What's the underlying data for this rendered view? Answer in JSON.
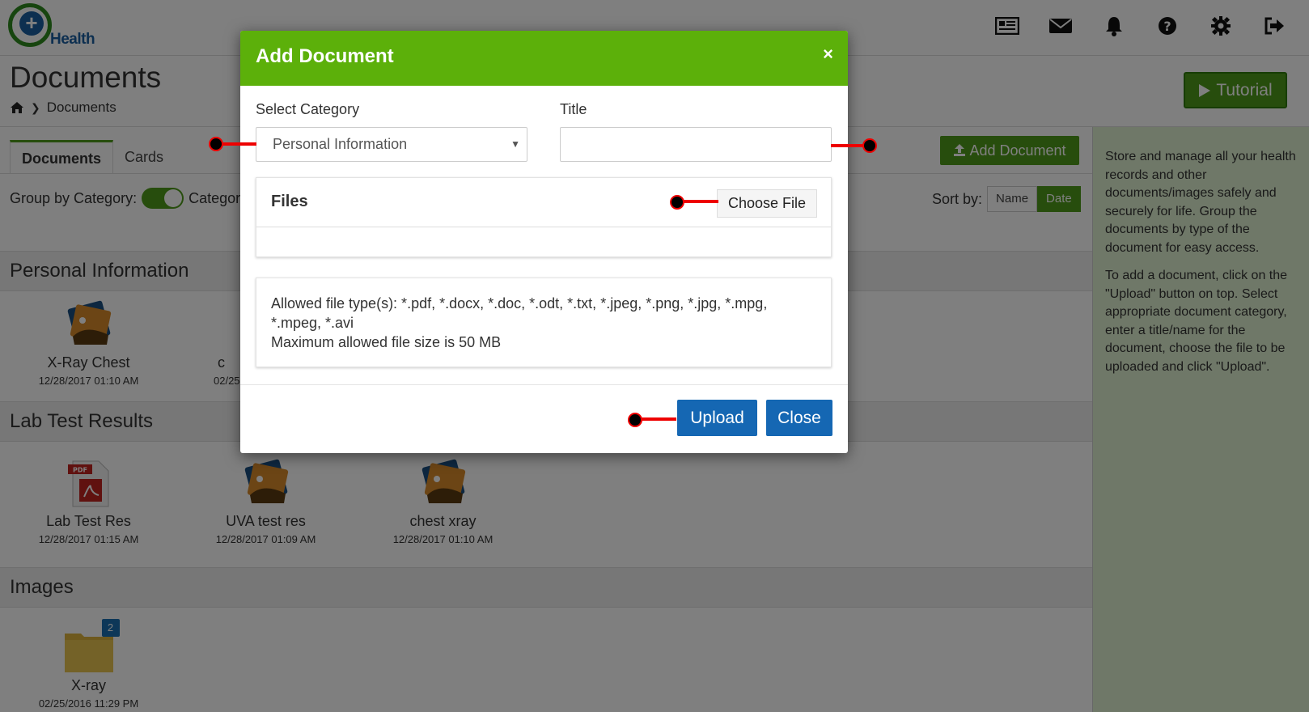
{
  "app": {
    "logo_text": "Health"
  },
  "page": {
    "title": "Documents",
    "breadcrumb": "Documents",
    "tutorial_label": "Tutorial"
  },
  "tabs": [
    "Documents",
    "Cards"
  ],
  "toolbar": {
    "add_document_label": "Add Document",
    "group_label": "Group by Category:",
    "group_toggle_text": "Category",
    "sort_label": "Sort by:",
    "sort_options": [
      "Name",
      "Date"
    ],
    "sort_selected": "Date"
  },
  "sections": [
    {
      "title": "Personal Information",
      "items": [
        {
          "name": "X-Ray Chest",
          "date": "12/28/2017 01:10 AM",
          "type": "image-icon"
        },
        {
          "name": "c",
          "date": "02/25",
          "type": "image-icon"
        }
      ]
    },
    {
      "title": "Lab Test Results",
      "items": [
        {
          "name": "Lab Test Res",
          "date": "12/28/2017 01:15 AM",
          "type": "pdf-icon"
        },
        {
          "name": "UVA test res",
          "date": "12/28/2017 01:09 AM",
          "type": "image-icon"
        },
        {
          "name": "chest xray",
          "date": "12/28/2017 01:10 AM",
          "type": "image-icon"
        }
      ]
    },
    {
      "title": "Images",
      "items": [
        {
          "name": "X-ray",
          "date": "02/25/2016 11:29 PM",
          "type": "folder-icon",
          "badge": "2"
        }
      ]
    }
  ],
  "sidebar": {
    "paragraphs": [
      "Store and manage all your health records and other documents/images safely and securely for life. Group the documents by type of the document for easy access.",
      "To add a document, click on the \"Upload\" button on top. Select appropriate document category, enter a title/name for the document, choose the file to be uploaded and click \"Upload\"."
    ]
  },
  "modal": {
    "title": "Add Document",
    "close_symbol": "×",
    "category_label": "Select Category",
    "category_value": "Personal Information",
    "title_label": "Title",
    "title_value": "",
    "files_title": "Files",
    "choose_file_label": "Choose File",
    "allowed_types": "Allowed file type(s): *.pdf, *.docx, *.doc, *.odt, *.txt, *.jpeg, *.png, *.jpg, *.mpg, *.mpeg, *.avi",
    "max_size": "Maximum allowed file size is 50 MB",
    "upload_label": "Upload",
    "close_label": "Close"
  },
  "icons": [
    "news-icon",
    "mail-icon",
    "bell-icon",
    "help-icon",
    "gear-icon",
    "logout-icon",
    "home-icon",
    "play-icon",
    "upload-icon"
  ],
  "colors": {
    "brand_green": "#5cb00a",
    "button_blue": "#1567b3",
    "sidebar_bg": "#dff0d0",
    "marker_red": "#e00000"
  }
}
